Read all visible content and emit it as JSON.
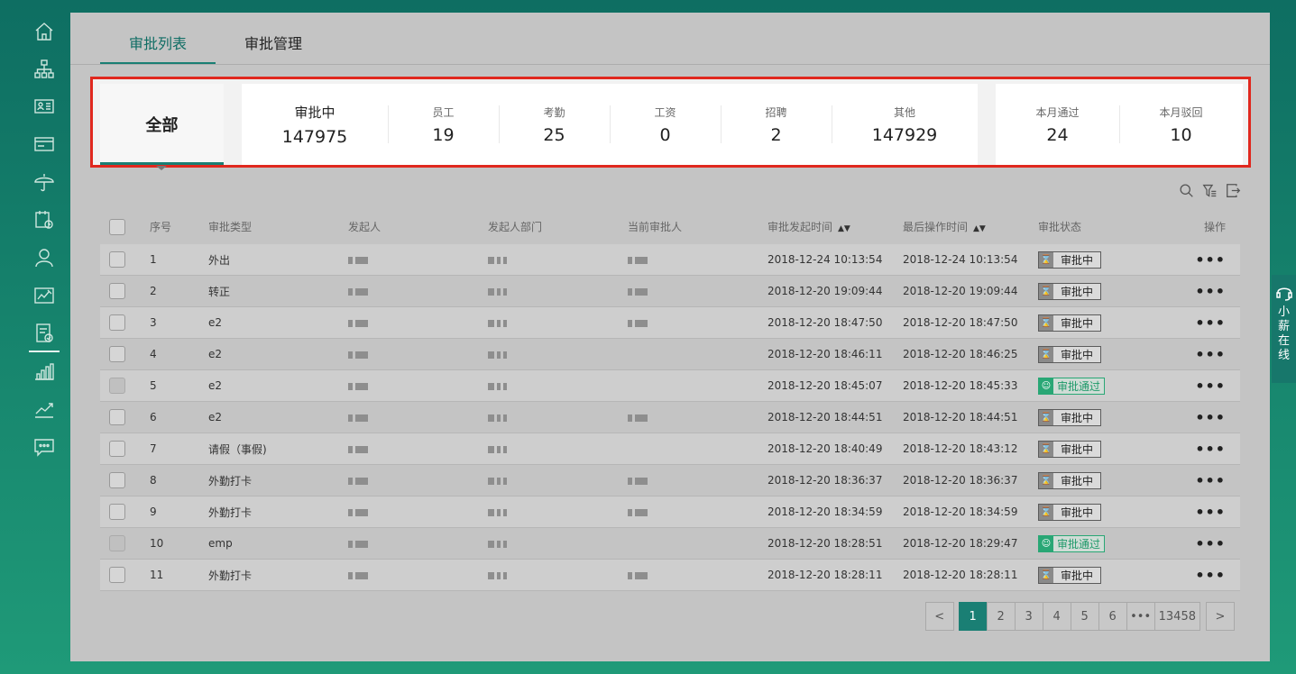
{
  "sidebar": {
    "icons": [
      "home-icon",
      "org-chart-icon",
      "id-card-icon",
      "card-icon",
      "umbrella-icon",
      "calendar-clock-icon",
      "user-icon",
      "chart-edit-icon",
      "approval-icon",
      "bar-chart-icon",
      "trend-icon",
      "chat-icon"
    ],
    "active": "approval-icon"
  },
  "tabs": [
    {
      "label": "审批列表",
      "active": true
    },
    {
      "label": "审批管理",
      "active": false
    }
  ],
  "stats": {
    "all_label": "全部",
    "pending": {
      "label": "审批中",
      "value": "147975"
    },
    "categories": [
      {
        "label": "员工",
        "value": "19"
      },
      {
        "label": "考勤",
        "value": "25"
      },
      {
        "label": "工资",
        "value": "0"
      },
      {
        "label": "招聘",
        "value": "2"
      },
      {
        "label": "其他",
        "value": "147929"
      }
    ],
    "monthly": [
      {
        "label": "本月通过",
        "value": "24"
      },
      {
        "label": "本月驳回",
        "value": "10"
      }
    ]
  },
  "toolbar": {
    "icons": [
      "search-icon",
      "filter-icon",
      "export-icon"
    ]
  },
  "table": {
    "headers": {
      "no": "序号",
      "type": "审批类型",
      "initiator": "发起人",
      "dept": "发起人部门",
      "approver": "当前审批人",
      "start": "审批发起时间",
      "last": "最后操作时间",
      "status": "审批状态",
      "op": "操作"
    },
    "rows": [
      {
        "no": "1",
        "type": "外出",
        "start": "2018-12-24 10:13:54",
        "last": "2018-12-24 10:13:54",
        "status": "审批中",
        "status_kind": "pending",
        "has_approver": true
      },
      {
        "no": "2",
        "type": "转正",
        "start": "2018-12-20 19:09:44",
        "last": "2018-12-20 19:09:44",
        "status": "审批中",
        "status_kind": "pending",
        "has_approver": true
      },
      {
        "no": "3",
        "type": "e2",
        "start": "2018-12-20 18:47:50",
        "last": "2018-12-20 18:47:50",
        "status": "审批中",
        "status_kind": "pending",
        "has_approver": true
      },
      {
        "no": "4",
        "type": "e2",
        "start": "2018-12-20 18:46:11",
        "last": "2018-12-20 18:46:25",
        "status": "审批中",
        "status_kind": "pending",
        "has_approver": false
      },
      {
        "no": "5",
        "type": "e2",
        "start": "2018-12-20 18:45:07",
        "last": "2018-12-20 18:45:33",
        "status": "审批通过",
        "status_kind": "pass",
        "has_approver": false
      },
      {
        "no": "6",
        "type": "e2",
        "start": "2018-12-20 18:44:51",
        "last": "2018-12-20 18:44:51",
        "status": "审批中",
        "status_kind": "pending",
        "has_approver": true
      },
      {
        "no": "7",
        "type": "请假（事假)",
        "start": "2018-12-20 18:40:49",
        "last": "2018-12-20 18:43:12",
        "status": "审批中",
        "status_kind": "pending",
        "has_approver": false
      },
      {
        "no": "8",
        "type": "外勤打卡",
        "start": "2018-12-20 18:36:37",
        "last": "2018-12-20 18:36:37",
        "status": "审批中",
        "status_kind": "pending",
        "has_approver": true
      },
      {
        "no": "9",
        "type": "外勤打卡",
        "start": "2018-12-20 18:34:59",
        "last": "2018-12-20 18:34:59",
        "status": "审批中",
        "status_kind": "pending",
        "has_approver": true
      },
      {
        "no": "10",
        "type": "emp",
        "start": "2018-12-20 18:28:51",
        "last": "2018-12-20 18:29:47",
        "status": "审批通过",
        "status_kind": "pass",
        "has_approver": false
      },
      {
        "no": "11",
        "type": "外勤打卡",
        "start": "2018-12-20 18:28:11",
        "last": "2018-12-20 18:28:11",
        "status": "审批中",
        "status_kind": "pending",
        "has_approver": true
      }
    ],
    "more_label": "•••"
  },
  "pagination": {
    "pages": [
      "1",
      "2",
      "3",
      "4",
      "5",
      "6"
    ],
    "current": "1",
    "ellipsis": "•••",
    "last_page": "13458",
    "prev": "<",
    "next": ">"
  },
  "help": {
    "label": "小薪在线"
  },
  "colors": {
    "accent": "#1a7f74",
    "highlight_border": "#e0281e",
    "pass": "#29a775"
  }
}
